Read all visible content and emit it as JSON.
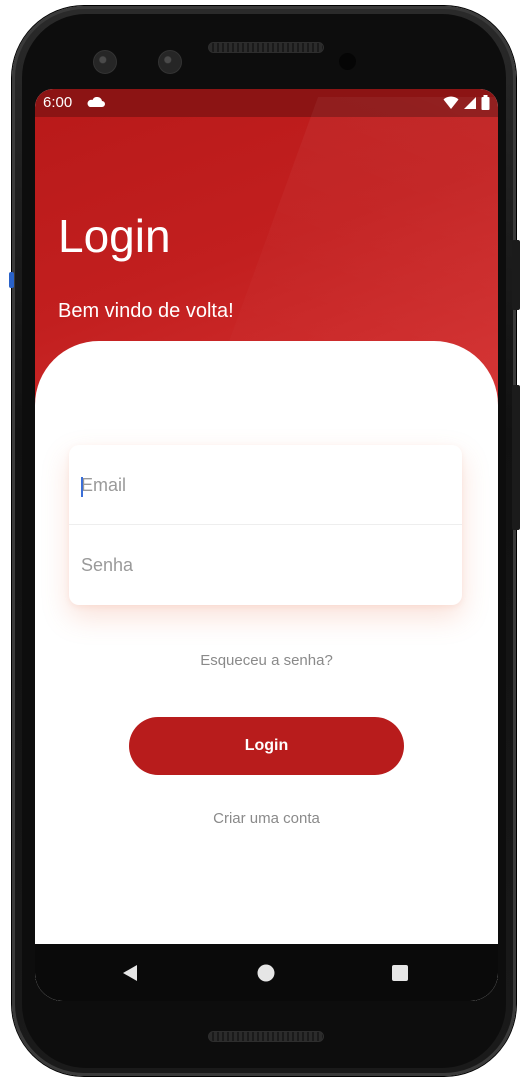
{
  "status_bar": {
    "time": "6:00",
    "icons": [
      "cloud-icon",
      "wifi-icon",
      "signal-icon",
      "battery-icon"
    ]
  },
  "header": {
    "title": "Login",
    "subtitle": "Bem vindo de volta!"
  },
  "form": {
    "email_placeholder": "Email",
    "password_placeholder": "Senha"
  },
  "links": {
    "forgot": "Esqueceu a senha?",
    "create_account": "Criar uma conta"
  },
  "button": {
    "login_label": "Login"
  },
  "nav": {
    "icons": [
      "back-icon",
      "home-icon",
      "recents-icon"
    ]
  },
  "colors": {
    "brand_red": "#b81c1c",
    "status_bar": "#8c1414",
    "caret": "#3b6fd8"
  }
}
